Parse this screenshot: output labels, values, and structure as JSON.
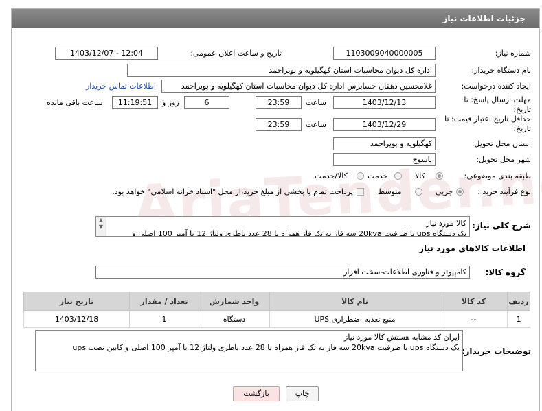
{
  "header": {
    "title": "جزئیات اطلاعات نیاز"
  },
  "fields": {
    "need_number_label": "شماره نیاز:",
    "need_number": "1103009040000005",
    "announce_label": "تاریخ و ساعت اعلان عمومی:",
    "announce_value": "1403/12/07 - 12:04",
    "buyer_label": "نام دستگاه خریدار:",
    "buyer": "اداره کل دیوان محاسبات استان کهگیلویه و بویراحمد",
    "creator_label": "ایجاد کننده درخواست:",
    "creator": "غلامحسین دهقان حسابرس اداره کل دیوان محاسبات استان کهگیلویه و بویراحمد",
    "contact_link": "اطلاعات تماس خریدار",
    "deadline_label": "مهلت ارسال پاسخ: تا تاریخ:",
    "deadline_date": "1403/12/13",
    "time_label": "ساعت",
    "deadline_time": "23:59",
    "days_value": "6",
    "days_label": "روز و",
    "remaining_time": "11:19:51",
    "remaining_label": "ساعت باقی مانده",
    "min_price_label": "حداقل تاریخ اعتبار قیمت: تا تاریخ:",
    "min_price_date": "1403/12/29",
    "min_price_time": "23:59",
    "province_label": "استان محل تحویل:",
    "province": "کهگیلویه و بویراحمد",
    "city_label": "شهر محل تحویل:",
    "city": "یاسوج",
    "category_label": "طبقه بندی موضوعی:",
    "category_options": [
      "کالا",
      "خدمت",
      "کالا/خدمت"
    ],
    "process_label": "نوع فرآیند خرید :",
    "process_options": [
      "جزیی",
      "متوسط"
    ],
    "payment_note": "پرداخت تمام یا بخشی از مبلغ خرید،از محل \"اسناد خزانه اسلامی\" خواهد بود."
  },
  "description": {
    "label": "شرح کلی نیاز:",
    "line1": "کالا مورد نیاز",
    "line2": "یک دستگاه ups  با ظرفیت 20kva سه فاز به تک فاز همراه با 28 عدد باطری ولتاژ 12 با آمپر 100 اصلی و"
  },
  "goods": {
    "section_title": "اطلاعات کالاهای مورد نیاز",
    "group_label": "گروه کالا:",
    "group_value": "کامپیوتر و فناوری اطلاعات-سخت افزار",
    "columns": [
      "ردیف",
      "کد کالا",
      "نام کالا",
      "واحد شمارش",
      "تعداد / مقدار",
      "تاریخ نیاز"
    ],
    "rows": [
      {
        "row": "1",
        "code": "--",
        "name": "منبع تغذیه اضطراری UPS",
        "unit": "دستگاه",
        "qty": "1",
        "date": "1403/12/18"
      }
    ]
  },
  "buyer_notes": {
    "label": "توضیحات خریدار:",
    "line1": "ایران کد مشابه هستش کالا مورد نیاز",
    "line2": "یک دستگاه ups  با ظرفیت 20kva سه فاز به تک فاز همراه با 28 عدد باطری ولتاژ 12 با آمپر 100 اصلی و کابین نصب ups"
  },
  "buttons": {
    "print": "چاپ",
    "back": "بازگشت"
  },
  "watermark": "AriaTender.neT"
}
